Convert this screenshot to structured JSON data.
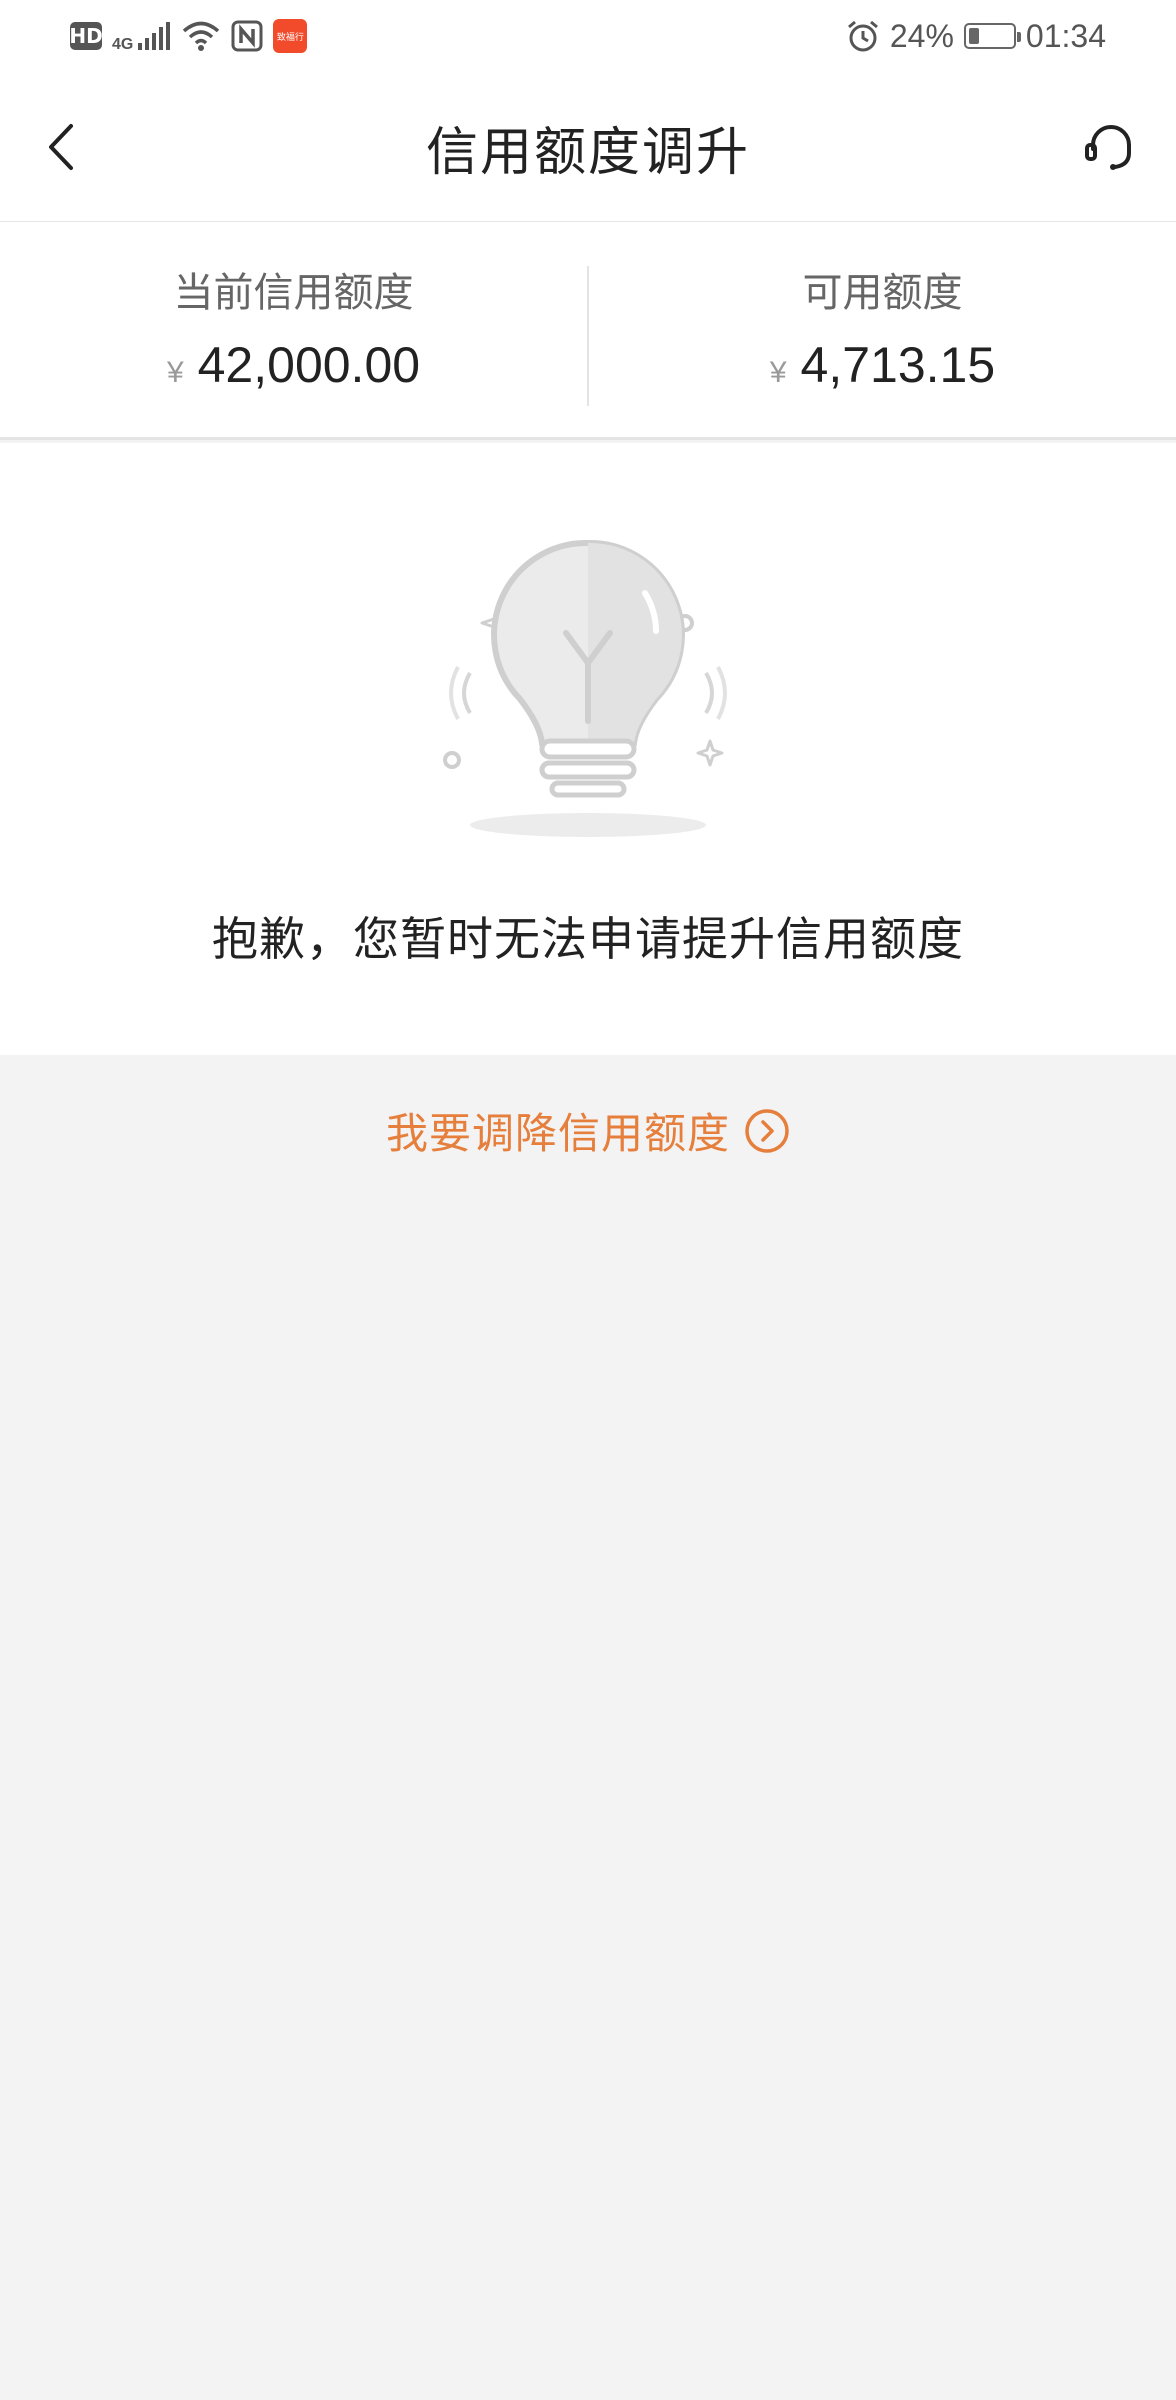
{
  "status_bar": {
    "hd": "HD",
    "network": "4G",
    "app_badge": "致福行",
    "battery": "24%",
    "battery_level": 0.24,
    "time": "01:34"
  },
  "nav": {
    "title": "信用额度调升",
    "back_icon": "chevron-left-icon",
    "service_icon": "headset-icon"
  },
  "limits": {
    "current": {
      "label": "当前信用额度",
      "currency": "¥",
      "amount": "42,000.00"
    },
    "available": {
      "label": "可用额度",
      "currency": "¥",
      "amount": "4,713.15"
    }
  },
  "empty_state": {
    "icon": "lightbulb-icon",
    "message": "抱歉，您暂时无法申请提升信用额度"
  },
  "reduce": {
    "label": "我要调降信用额度",
    "icon": "circle-chevron-right-icon"
  },
  "colors": {
    "accent": "#e67e3c",
    "background": "#f3f3f3",
    "panel": "#ffffff"
  }
}
